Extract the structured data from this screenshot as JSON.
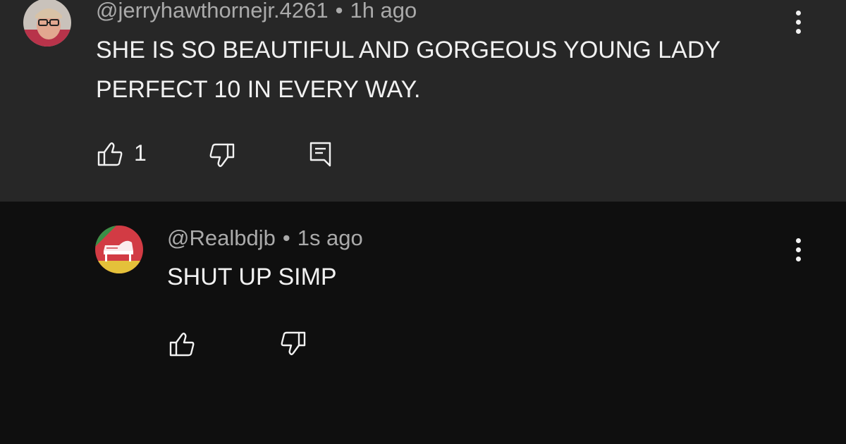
{
  "comments": [
    {
      "author": "@jerryhawthornejr.4261",
      "separator": "•",
      "time": "1h ago",
      "text": "SHE IS SO BEAUTIFUL AND GORGEOUS YOUNG LADY PERFECT 10 IN EVERY WAY.",
      "like_count": "1",
      "icons": {
        "like": "thumbs-up-icon",
        "dislike": "thumbs-down-icon",
        "reply": "reply-icon",
        "menu": "more-vert-icon"
      }
    },
    {
      "author": "@Realbdjb",
      "separator": "•",
      "time": "1s ago",
      "text": "SHUT UP SIMP",
      "icons": {
        "like": "thumbs-up-icon",
        "dislike": "thumbs-down-icon",
        "menu": "more-vert-icon"
      }
    }
  ],
  "colors": {
    "highlighted_bg": "#272727",
    "page_bg": "#0f0f0f",
    "primary_text": "#f1f1f1",
    "secondary_text": "#aaaaaa"
  }
}
